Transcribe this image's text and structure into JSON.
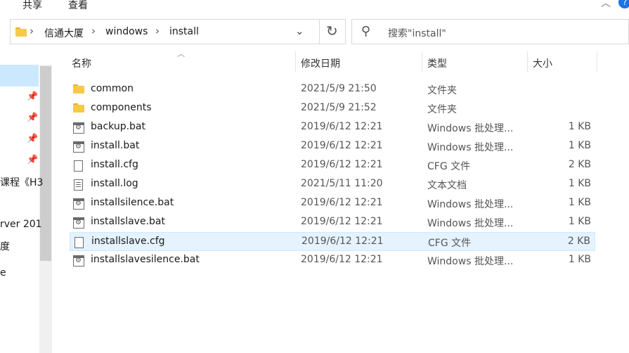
{
  "ribbon": {
    "share": "共享",
    "view": "查看"
  },
  "address": {
    "crumbs": [
      "信通大厦",
      "windows",
      "install"
    ]
  },
  "search": {
    "placeholder": "搜索\"install\""
  },
  "nav": {
    "items": [
      "课程《H3",
      "rver 201",
      "度",
      "e"
    ]
  },
  "columns": {
    "name": "名称",
    "date": "修改日期",
    "type": "类型",
    "size": "大小"
  },
  "files": [
    {
      "name": "common",
      "date": "2021/5/9 21:50",
      "type": "文件夹",
      "size": "",
      "icon": "folder-icon"
    },
    {
      "name": "components",
      "date": "2021/5/9 21:52",
      "type": "文件夹",
      "size": "",
      "icon": "folder-icon"
    },
    {
      "name": "backup.bat",
      "date": "2019/6/12 12:21",
      "type": "Windows 批处理...",
      "size": "1 KB",
      "icon": "batch-file-icon"
    },
    {
      "name": "install.bat",
      "date": "2019/6/12 12:21",
      "type": "Windows 批处理...",
      "size": "1 KB",
      "icon": "batch-file-icon"
    },
    {
      "name": "install.cfg",
      "date": "2019/6/12 12:21",
      "type": "CFG 文件",
      "size": "2 KB",
      "icon": "file-icon"
    },
    {
      "name": "install.log",
      "date": "2021/5/11 11:20",
      "type": "文本文档",
      "size": "1 KB",
      "icon": "text-file-icon"
    },
    {
      "name": "installsilence.bat",
      "date": "2019/6/12 12:21",
      "type": "Windows 批处理...",
      "size": "1 KB",
      "icon": "batch-file-icon"
    },
    {
      "name": "installslave.bat",
      "date": "2019/6/12 12:21",
      "type": "Windows 批处理...",
      "size": "1 KB",
      "icon": "batch-file-icon"
    },
    {
      "name": "installslave.cfg",
      "date": "2019/6/12 12:21",
      "type": "CFG 文件",
      "size": "2 KB",
      "icon": "file-icon",
      "selected": true
    },
    {
      "name": "installslavesilence.bat",
      "date": "2019/6/12 12:21",
      "type": "Windows 批处理...",
      "size": "1 KB",
      "icon": "batch-file-icon"
    }
  ],
  "colors": {
    "selection": "#cce8ff",
    "hover": "#e5f3ff",
    "folder": "#f7c948",
    "help": "#1a73e8"
  }
}
